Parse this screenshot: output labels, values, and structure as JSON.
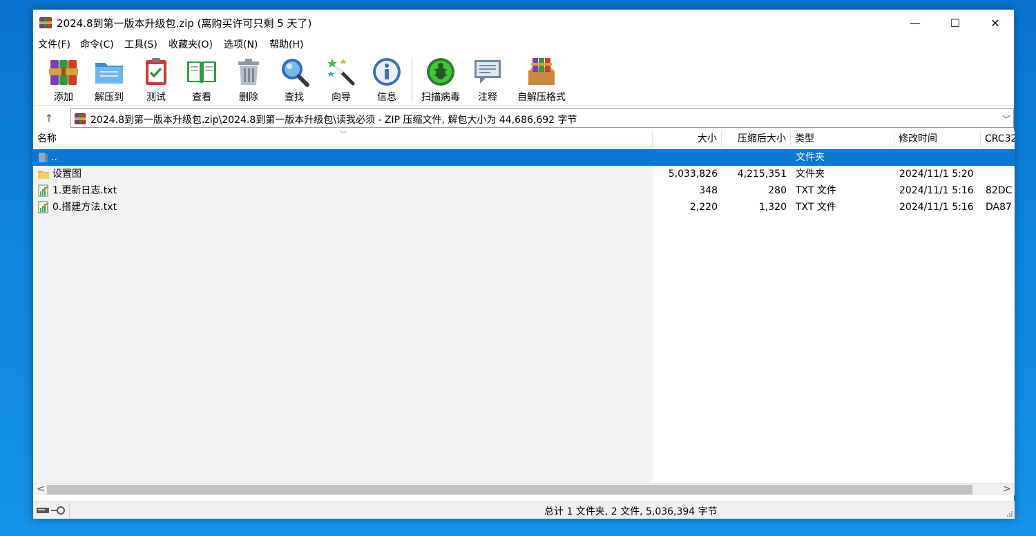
{
  "window": {
    "title": "2024.8到第一版本升级包.zip (离购买许可只剩 5 天了)",
    "controls": {
      "minimize": "—",
      "maximize": "☐",
      "close": "✕"
    }
  },
  "menu": [
    {
      "label": "文件(F)"
    },
    {
      "label": "命令(C)"
    },
    {
      "label": "工具(S)"
    },
    {
      "label": "收藏夹(O)"
    },
    {
      "label": "选项(N)"
    },
    {
      "label": "帮助(H)"
    }
  ],
  "toolbar": [
    {
      "label": "添加",
      "icon": "add-archive-icon"
    },
    {
      "label": "解压到",
      "icon": "extract-to-icon"
    },
    {
      "label": "测试",
      "icon": "test-icon"
    },
    {
      "label": "查看",
      "icon": "view-icon"
    },
    {
      "label": "删除",
      "icon": "delete-icon"
    },
    {
      "label": "查找",
      "icon": "find-icon"
    },
    {
      "label": "向导",
      "icon": "wizard-icon"
    },
    {
      "label": "信息",
      "icon": "info-icon"
    },
    {
      "label": "扫描病毒",
      "icon": "virus-scan-icon"
    },
    {
      "label": "注释",
      "icon": "comment-icon"
    },
    {
      "label": "自解压格式",
      "icon": "sfx-icon"
    }
  ],
  "address": {
    "up_glyph": "↑",
    "path": "2024.8到第一版本升级包.zip\\2024.8到第一版本升级包\\读我必须 - ZIP 压缩文件, 解包大小为 44,686,692 字节",
    "dropdown_glyph": "﹀"
  },
  "columns": {
    "name": "名称",
    "size": "大小",
    "packed": "压缩后大小",
    "type": "类型",
    "modified": "修改时间",
    "crc": "CRC32"
  },
  "sort_caret": "﹀",
  "files": [
    {
      "name": "..",
      "size": "",
      "packed": "",
      "type": "文件夹",
      "modified": "",
      "crc": "",
      "icon": "parent-folder-icon",
      "selected": true
    },
    {
      "name": "设置图",
      "size": "5,033,826",
      "packed": "4,215,351",
      "type": "文件夹",
      "modified": "2024/11/1 5:20",
      "crc": "",
      "icon": "folder-icon",
      "selected": false
    },
    {
      "name": "1.更新日志.txt",
      "size": "348",
      "packed": "280",
      "type": "TXT 文件",
      "modified": "2024/11/1 5:16",
      "crc": "82DC",
      "icon": "text-file-icon",
      "selected": false
    },
    {
      "name": "0.搭建方法.txt",
      "size": "2,220",
      "packed": "1,320",
      "type": "TXT 文件",
      "modified": "2024/11/1 5:16",
      "crc": "DA87",
      "icon": "text-file-icon",
      "selected": false
    }
  ],
  "scroll": {
    "left": "<",
    "right": ">"
  },
  "status": {
    "summary": "总计 1 文件夹, 2 文件, 5,036,394 字节"
  }
}
